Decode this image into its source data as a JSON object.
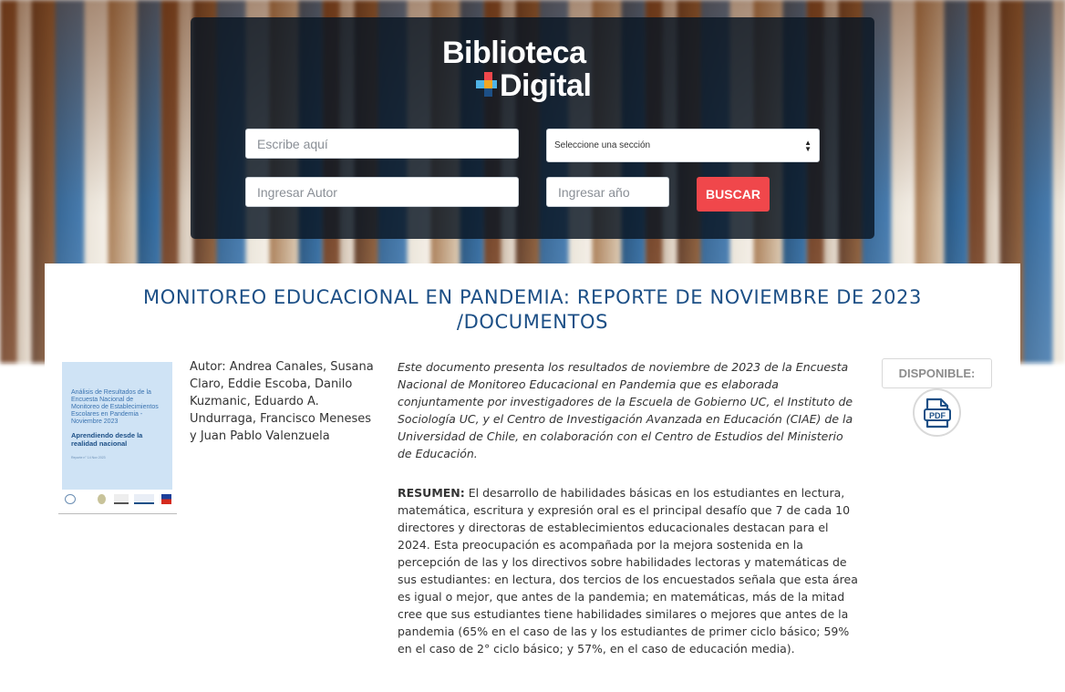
{
  "logo": {
    "line1": "Biblioteca",
    "line2": "Digital"
  },
  "search": {
    "keyword_placeholder": "Escribe aquí",
    "section_select_value": "Seleccione una sección",
    "author_placeholder": "Ingresar Autor",
    "year_placeholder": "Ingresar año",
    "search_button_label": "BUSCAR"
  },
  "document": {
    "title_line1": "MONITOREO EDUCACIONAL EN PANDEMIA: REPORTE DE NOVIEMBRE DE 2023",
    "title_line2": "/DOCUMENTOS",
    "cover": {
      "text1": "Análisis de Resultados de la Encuesta Nacional de Monitoreo de Establecimientos Escolares en Pandemia - Noviembre 2023",
      "text2": "Aprendiendo desde la realidad nacional",
      "text3": "Reporte n° 14 Nov 2023"
    },
    "author": "Autor: Andrea Canales, Susana Claro, Eddie Escoba, Danilo Kuzmanic, Eduardo A. Undurraga, Francisco Meneses y Juan Pablo Valenzuela",
    "description": "Este documento presenta los resultados de noviembre de 2023 de la Encuesta Nacional de Monitoreo Educacional en Pandemia que es elaborada conjuntamente por investigadores de la Escuela de Gobierno UC, el Instituto de Sociología UC, y el Centro de Investigación Avanzada en Educación (CIAE) de la Universidad de Chile, en colaboración con el Centro de Estudios del Ministerio de Educación.",
    "summary_label": "RESUMEN:",
    "summary_text": " El desarrollo de habilidades básicas en los estudiantes en lectura, matemática, escritura y expresión oral es el principal desafío que 7 de cada 10 directores y directoras de establecimientos educacionales destacan para el 2024. Esta preocupación es acompañada por la mejora sostenida en la percepción de las y los directivos sobre habilidades lectoras y matemáticas de sus estudiantes: en lectura, dos tercios de los encuestados señala que esta área es igual o mejor, que antes de la pandemia; en matemáticas, más de la mitad cree que sus estudiantes tiene habilidades similares o mejores que antes de la pandemia (65% en el caso de las y los estudiantes de primer ciclo básico; 59% en el caso de 2° ciclo básico; y 57%, en el caso de educación media).",
    "availability_label": "DISPONIBLE:",
    "pdf_icon_text": "PDF"
  },
  "colors": {
    "title_blue": "#1c4f86",
    "search_button": "#f0474b",
    "panel_bg": "#0a1623"
  }
}
